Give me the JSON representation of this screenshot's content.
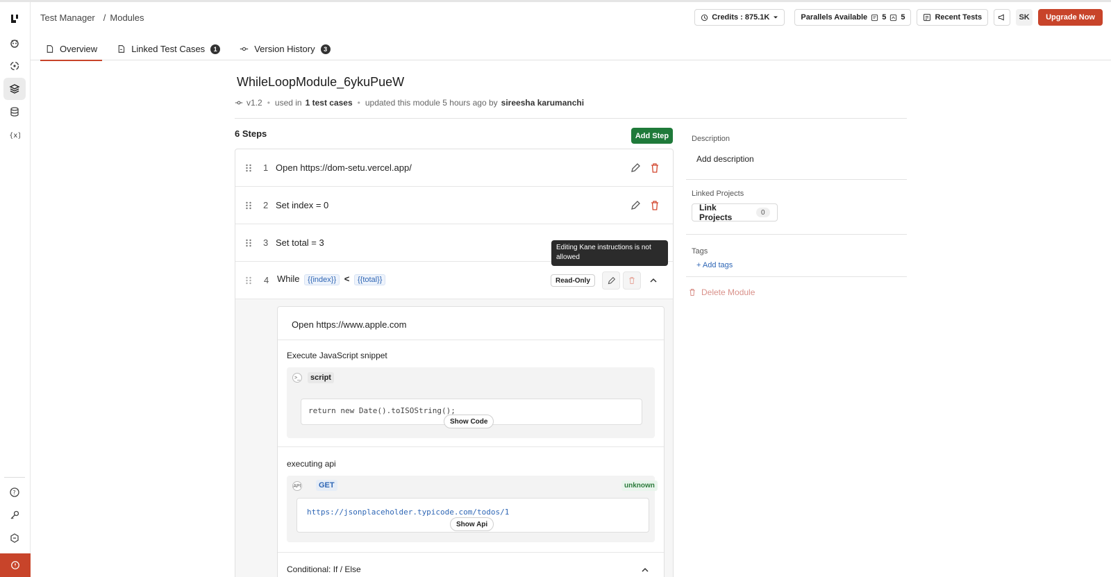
{
  "header": {
    "breadcrumb": [
      "Test Manager",
      "Modules"
    ],
    "credits_label": "Credits : 875.1K",
    "parallels_label": "Parallels Available",
    "parallels_a": "5",
    "parallels_b": "5",
    "recent_tests": "Recent Tests",
    "avatar": "SK",
    "upgrade": "Upgrade Now"
  },
  "tabs": [
    {
      "label": "Overview",
      "count": ""
    },
    {
      "label": "Linked Test Cases",
      "count": "1"
    },
    {
      "label": "Version History",
      "count": "3"
    }
  ],
  "module": {
    "title": "WhileLoopModule_6ykuPueW",
    "version": "v1.2",
    "used_in_prefix": "used in",
    "used_in_count": "1 test cases",
    "updated": "updated this module 5 hours ago by",
    "author": "sireesha karumanchi"
  },
  "steps_header": "6 Steps",
  "add_step": "Add Step",
  "steps": [
    {
      "num": "1",
      "text": "Open https://dom-setu.vercel.app/"
    },
    {
      "num": "2",
      "text": "Set index = 0"
    },
    {
      "num": "3",
      "text": "Set total = 3"
    }
  ],
  "step4": {
    "num": "4",
    "keyword": "While",
    "var_a": "{{index}}",
    "op": "<",
    "var_b": "{{total}}",
    "readonly": "Read-Only"
  },
  "tooltip": "Editing Kane instructions is not allowed",
  "nested": {
    "open": "Open https://www.apple.com",
    "js_title": "Execute JavaScript snippet",
    "js_chip": "script",
    "js_code": "return new Date().toISOString();",
    "show_code": "Show Code",
    "api_title": "executing api",
    "api_method": "GET",
    "api_status": "unknown",
    "api_url": "https://jsonplaceholder.typicode.com/todos/1",
    "show_api": "Show Api",
    "api_icon_text": "API",
    "conditional": "Conditional: If / Else"
  },
  "right_panel": {
    "description_label": "Description",
    "description_value": "Add description",
    "linked_projects_label": "Linked Projects",
    "link_projects_btn": "Link Projects",
    "link_projects_count": "0",
    "tags_label": "Tags",
    "add_tags": "+ Add tags",
    "delete_module": "Delete Module"
  },
  "colors": {
    "accent": "#c8442a",
    "add_step_green": "#1f7a3a",
    "link_blue": "#2e66b5"
  }
}
